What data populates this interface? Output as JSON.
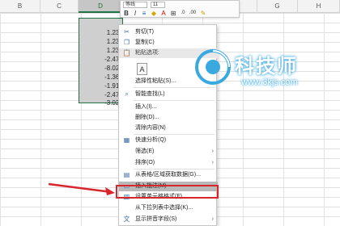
{
  "sheet": {
    "columns": [
      "B",
      "C",
      "D",
      "E",
      "F",
      "G",
      "H",
      "I"
    ],
    "selected_column": "D",
    "values": [
      "1.23(",
      "1.23(",
      "1.23(",
      "-2.47(",
      "-8.02(",
      "-1.36(",
      "-1.91(",
      "-2.47(",
      "-3.02("
    ]
  },
  "mini_toolbar": {
    "font_name": "等线",
    "font_size": "11",
    "bold": "B",
    "italic": "I",
    "underline": "U",
    "font_color": "A"
  },
  "context_menu": {
    "items": [
      {
        "label": "剪切(T)",
        "icon": "scissors-icon"
      },
      {
        "label": "复制(C)",
        "icon": "copy-icon"
      },
      {
        "label": "粘贴选项:",
        "icon": "paste-icon"
      },
      {
        "label": "选择性粘贴(S)...",
        "icon": ""
      },
      {
        "label": "智能查找(L)",
        "icon": "search-icon"
      },
      {
        "label": "插入(I)...",
        "icon": ""
      },
      {
        "label": "删除(D)...",
        "icon": ""
      },
      {
        "label": "清除内容(N)",
        "icon": ""
      },
      {
        "label": "快速分析(Q)",
        "icon": "quick-analysis-icon"
      },
      {
        "label": "筛选(E)",
        "icon": ""
      },
      {
        "label": "排序(O)",
        "icon": ""
      },
      {
        "label": "从表格/区域获取数据(G)...",
        "icon": "table-icon"
      },
      {
        "label": "插入批注(M)",
        "icon": "comment-icon"
      },
      {
        "label": "设置单元格格式(F)...",
        "icon": "format-cells-icon"
      },
      {
        "label": "从下拉列表中选择(K)...",
        "icon": ""
      },
      {
        "label": "显示拼音字段(S)",
        "icon": "pinyin-icon"
      }
    ],
    "paste_option_glyph": "A"
  },
  "watermark": {
    "title": "科技师",
    "url": "www.3kjs.com"
  },
  "colors": {
    "selection_border": "#217346",
    "highlight": "#d7262c",
    "watermark_accent": "#3aa9e0"
  }
}
